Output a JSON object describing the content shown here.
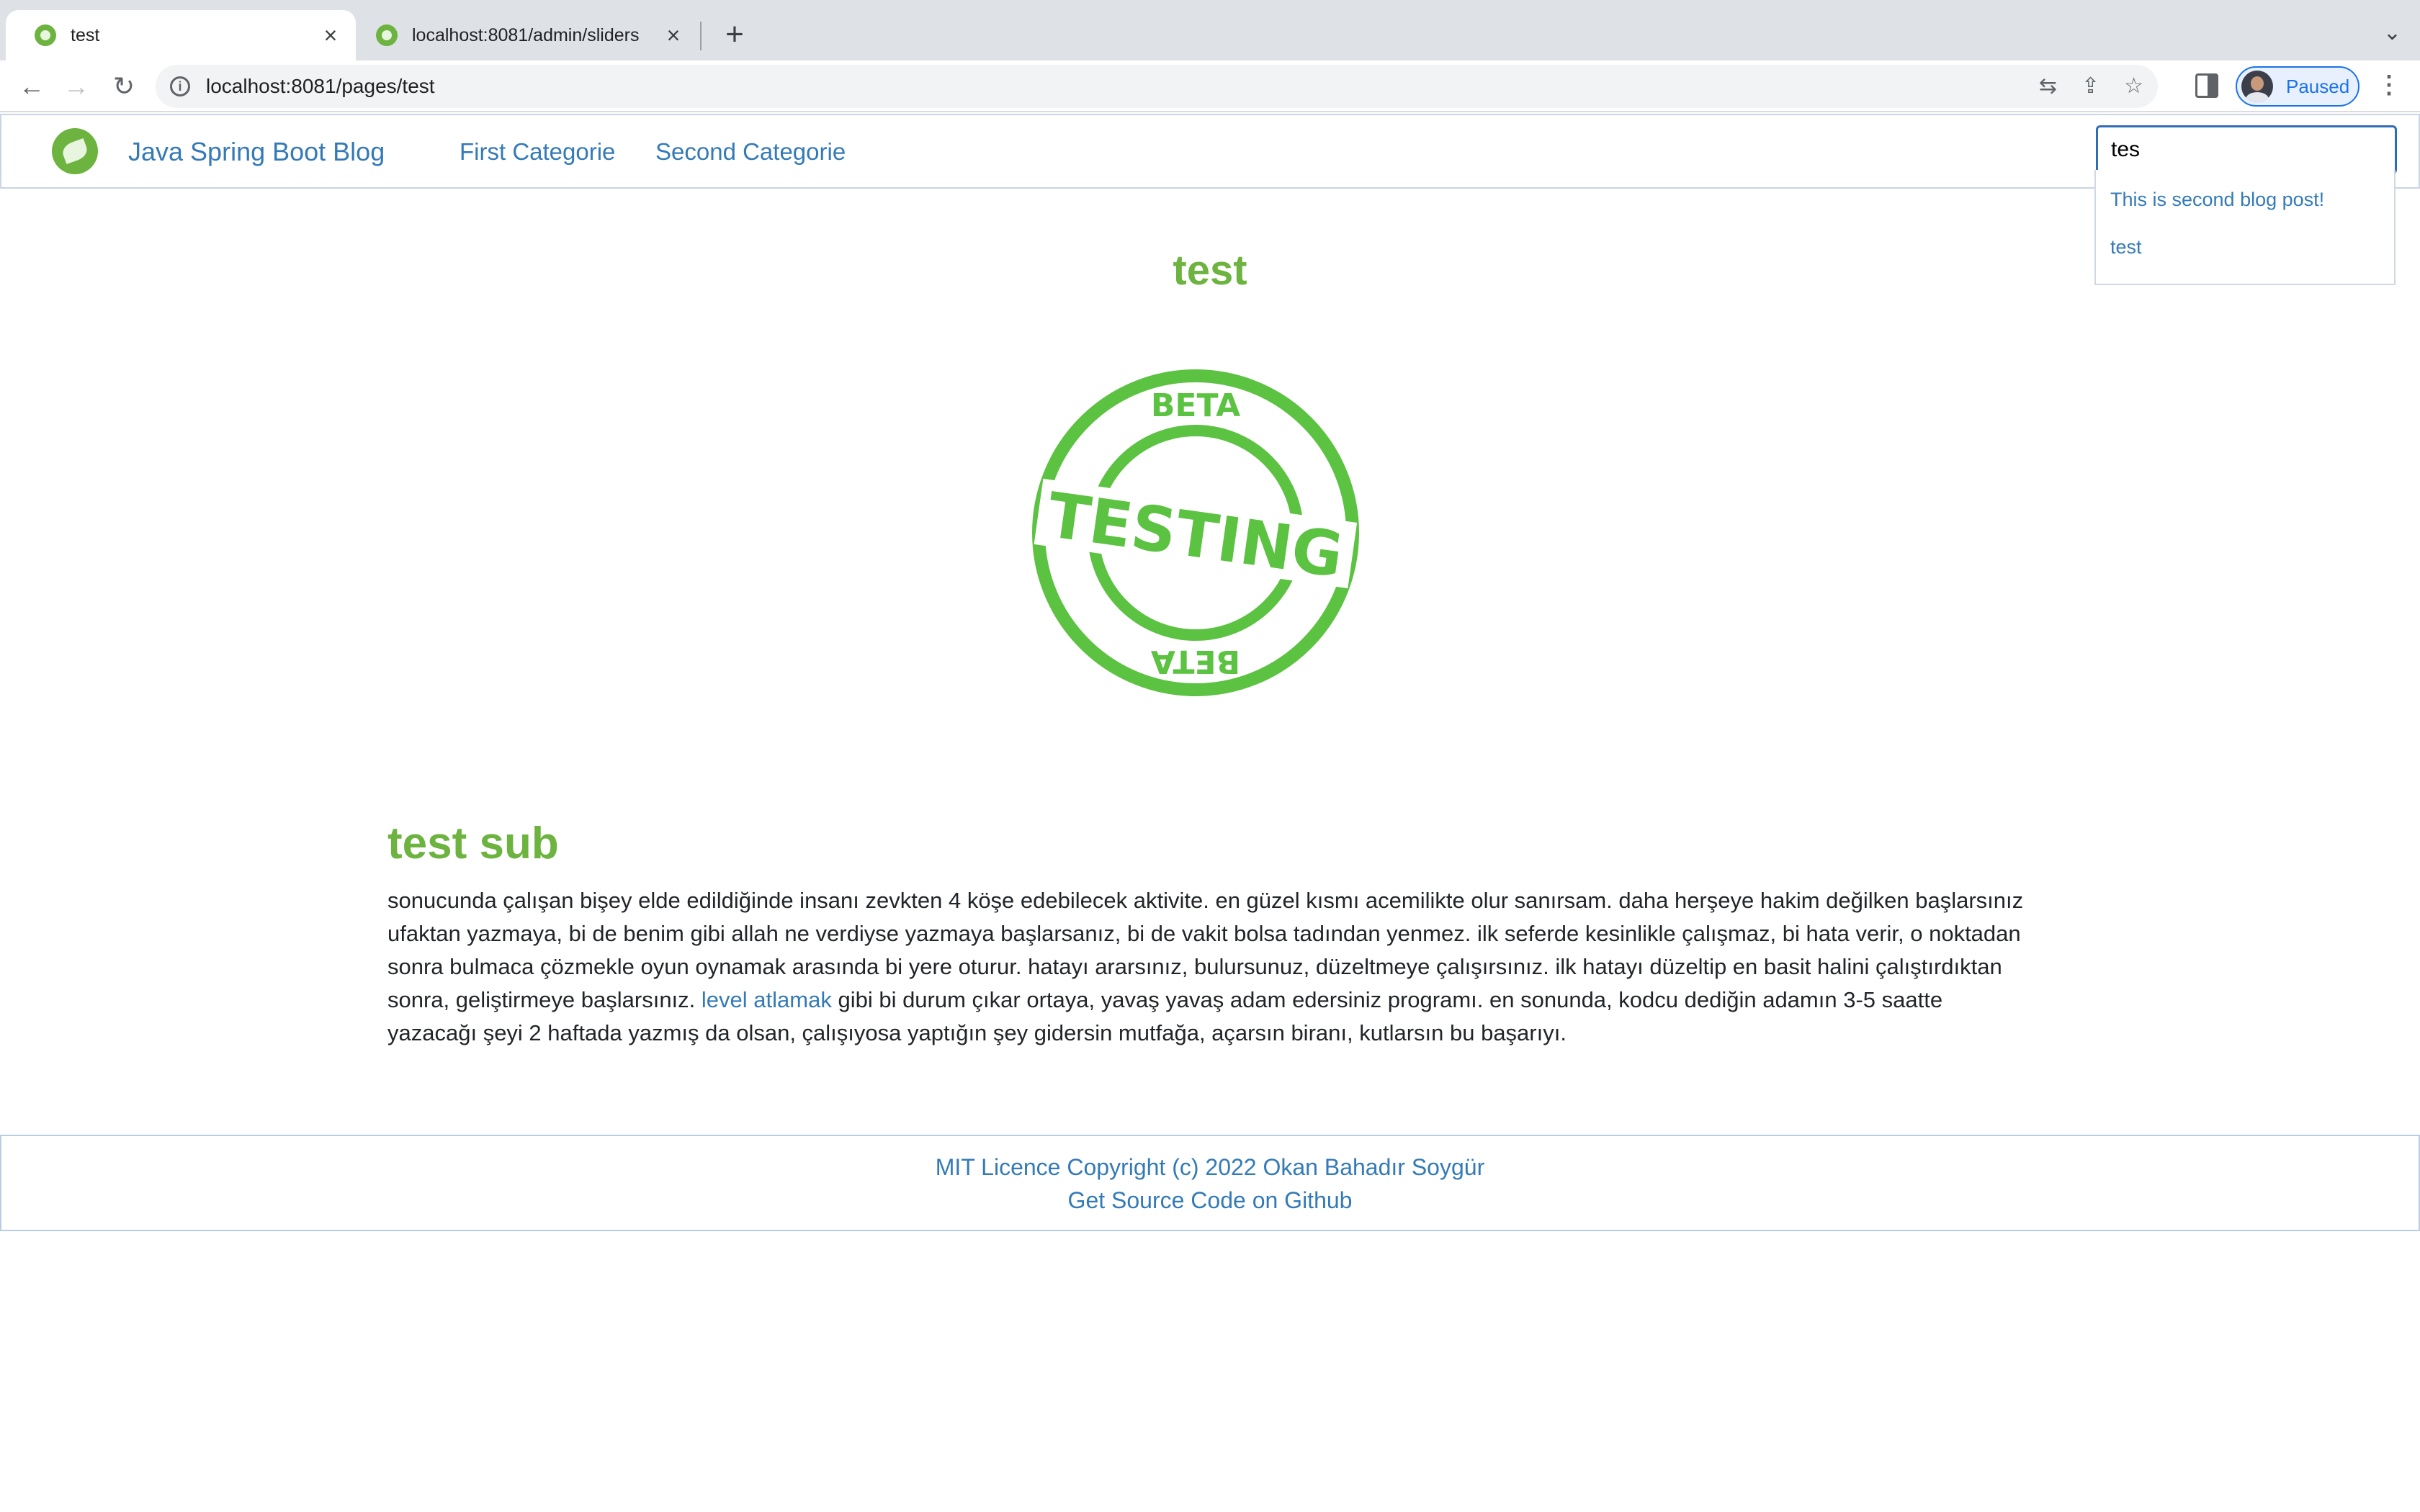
{
  "browser": {
    "tabs": [
      {
        "title": "test",
        "active": true
      },
      {
        "title": "localhost:8081/admin/sliders",
        "active": false
      }
    ],
    "url": "localhost:8081/pages/test",
    "profile_label": "Paused"
  },
  "navbar": {
    "brand": "Java Spring Boot Blog",
    "links": [
      "First Categorie",
      "Second Categorie"
    ],
    "search_value": "tes",
    "suggestions": [
      "This is second blog post!",
      "test"
    ]
  },
  "page": {
    "title": "test",
    "stamp": {
      "top_text": "BETA",
      "center_text": "TESTING",
      "bottom_text": "BETA",
      "color": "#5cc241"
    },
    "section_title": "test sub",
    "paragraph_before_link": "sonucunda çalışan bişey elde edildiğinde insanı zevkten 4 köşe edebilecek aktivite. en güzel kısmı acemilikte olur sanırsam. daha herşeye hakim değilken başlarsınız ufaktan yazmaya, bi de benim gibi allah ne verdiyse yazmaya başlarsanız, bi de vakit bolsa tadından yenmez. ilk seferde kesinlikle çalışmaz, bi hata verir, o noktadan sonra bulmaca çözmekle oyun oynamak arasında bi yere oturur. hatayı ararsınız, bulursunuz, düzeltmeye çalışırsınız. ilk hatayı düzeltip en basit halini çalıştırdıktan sonra, geliştirmeye başlarsınız.",
    "paragraph_link": "level atlamak",
    "paragraph_after_link": "gibi bi durum çıkar ortaya, yavaş yavaş adam edersiniz programı. en sonunda, kodcu dediğin adamın 3-5 saatte yazacağı şeyi 2 haftada yazmış da olsan, çalışıyosa yaptığın şey gidersin mutfağa, açarsın biranı, kutlarsın bu başarıyı."
  },
  "footer": {
    "copyright": "MIT Licence Copyright (c) 2022 Okan Bahadır Soygür",
    "source_link": "Get Source Code on Github"
  },
  "colors": {
    "accent_green": "#6db33f",
    "link_blue": "#337ab7"
  }
}
